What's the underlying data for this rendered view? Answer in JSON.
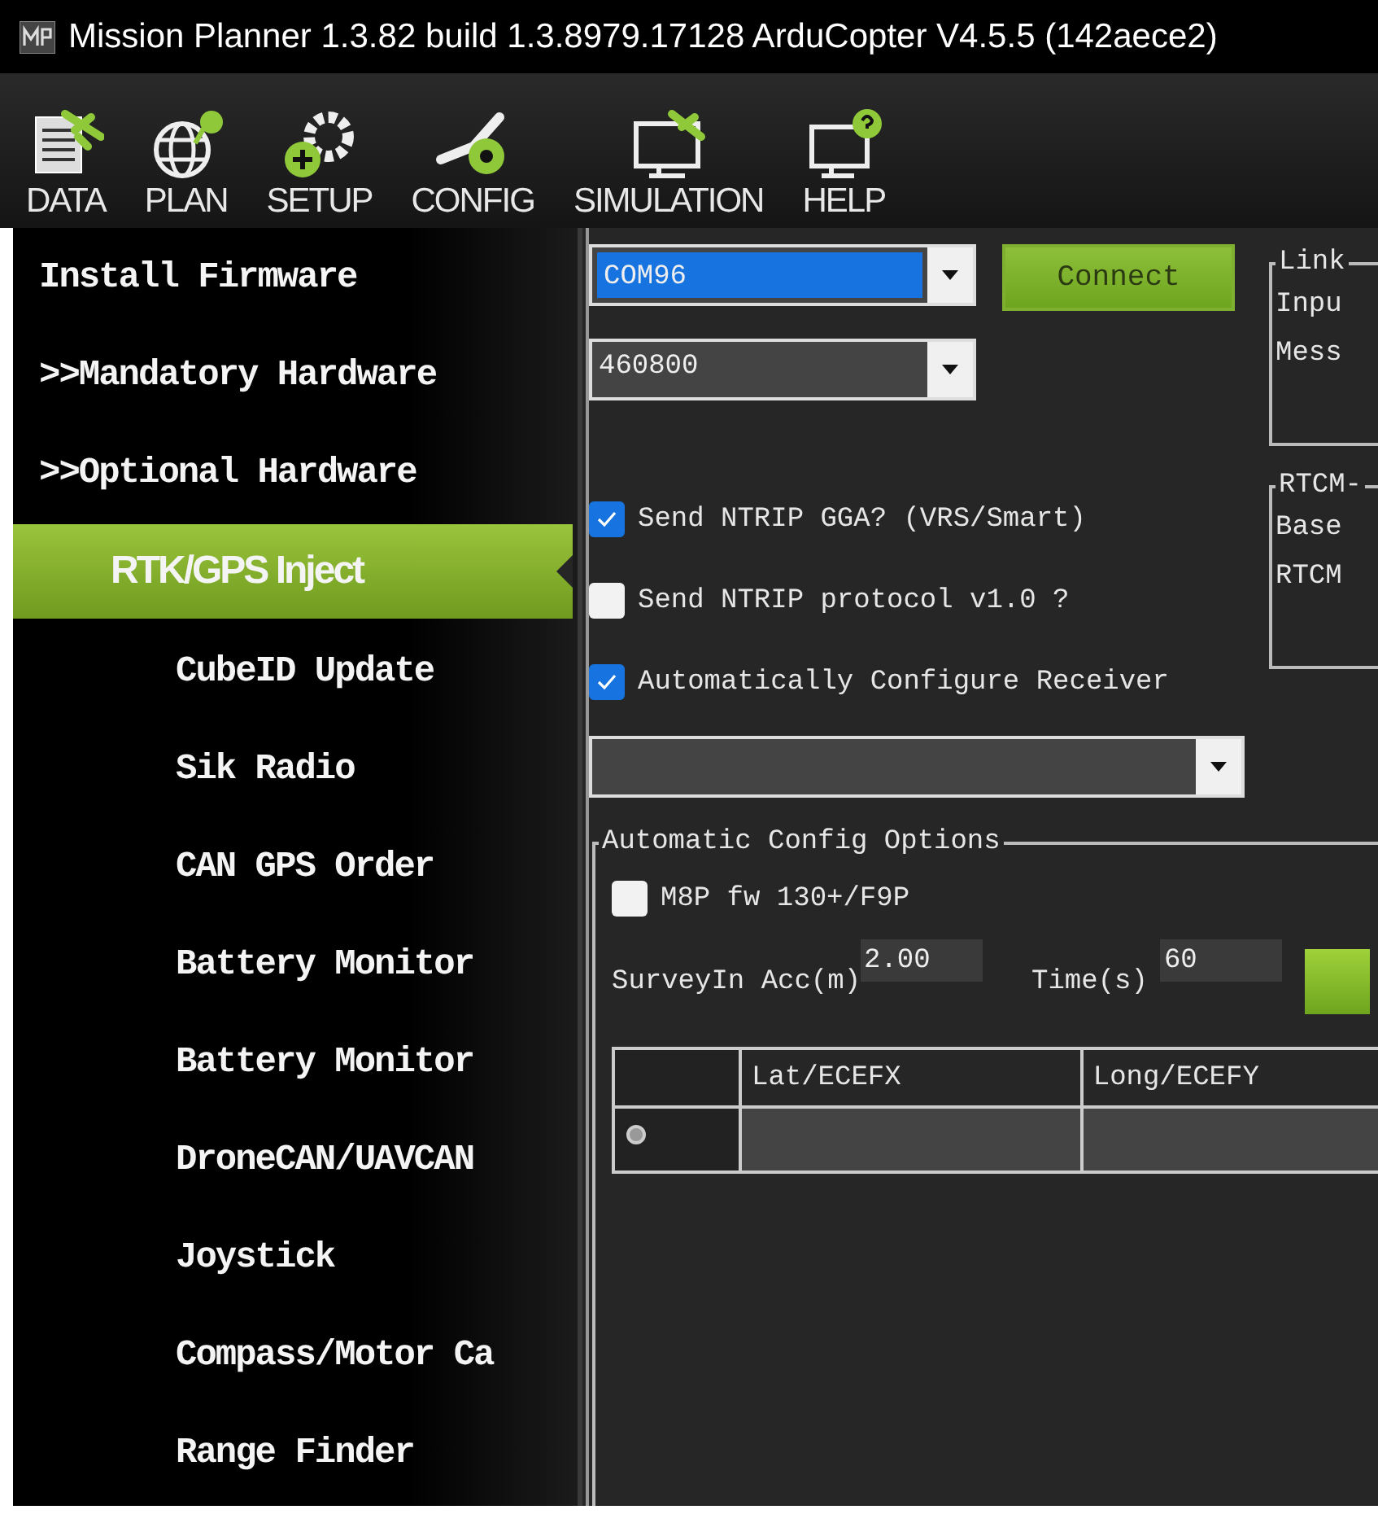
{
  "window": {
    "title": "Mission Planner 1.3.82 build 1.3.8979.17128 ArduCopter V4.5.5 (142aece2)"
  },
  "toolbar": [
    {
      "label": "DATA",
      "kind": "data"
    },
    {
      "label": "PLAN",
      "kind": "plan"
    },
    {
      "label": "SETUP",
      "kind": "setup"
    },
    {
      "label": "CONFIG",
      "kind": "config"
    },
    {
      "label": "SIMULATION",
      "kind": "simulation"
    },
    {
      "label": "HELP",
      "kind": "help"
    }
  ],
  "sidebar": {
    "items": [
      {
        "label": "Install Firmware",
        "selected": false
      },
      {
        "label": ">>Mandatory Hardware",
        "selected": false
      },
      {
        "label": ">>Optional Hardware",
        "selected": false,
        "children": [
          {
            "label": "RTK/GPS Inject",
            "selected": true
          },
          {
            "label": "CubeID Update",
            "selected": false
          },
          {
            "label": "Sik Radio",
            "selected": false
          },
          {
            "label": "CAN GPS Order",
            "selected": false
          },
          {
            "label": "Battery Monitor",
            "selected": false
          },
          {
            "label": "Battery Monitor",
            "selected": false
          },
          {
            "label": "DroneCAN/UAVCAN",
            "selected": false
          },
          {
            "label": "Joystick",
            "selected": false
          },
          {
            "label": "Compass/Motor Ca",
            "selected": false
          },
          {
            "label": "Range Finder",
            "selected": false
          }
        ]
      }
    ]
  },
  "connection": {
    "port": {
      "value": "COM96",
      "focused": true
    },
    "baud": {
      "value": "460800",
      "focused": false
    },
    "connect_button": "Connect"
  },
  "options": [
    {
      "label": "Send NTRIP GGA? (VRS/Smart)",
      "checked": true
    },
    {
      "label": "Send NTRIP protocol v1.0 ?",
      "checked": false
    },
    {
      "label": "Automatically Configure Receiver",
      "checked": true
    }
  ],
  "link_group": {
    "title": "Link",
    "lines": [
      "Inpu",
      "Mess"
    ]
  },
  "rtcm_group": {
    "title": "RTCM-",
    "lines": [
      "Base",
      "RTCM"
    ]
  },
  "auto_config": {
    "title": "Automatic Config Options",
    "checkbox": {
      "label": "M8P fw 130+/F9P",
      "checked": false
    },
    "survey_acc": {
      "label": "SurveyIn Acc(m)",
      "value": "2.00"
    },
    "time": {
      "label": "Time(s)",
      "value": "60"
    },
    "table": {
      "columns": [
        "Lat/ECEFX",
        "Long/ECEFY"
      ],
      "rows": [
        {
          "current": true
        }
      ]
    }
  }
}
